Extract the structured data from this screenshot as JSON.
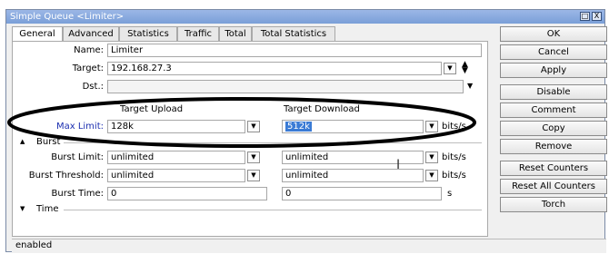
{
  "window": {
    "title": "Simple Queue <Limiter>",
    "title_buttons": [
      "□",
      "X"
    ]
  },
  "tabs": [
    "General",
    "Advanced",
    "Statistics",
    "Traffic",
    "Total",
    "Total Statistics"
  ],
  "general": {
    "name_label": "Name:",
    "name_value": "Limiter",
    "target_label": "Target:",
    "target_value": "192.168.27.3",
    "dst_label": "Dst.:",
    "dst_value": "",
    "col_upload": "Target Upload",
    "col_download": "Target Download",
    "max_limit_label": "Max Limit:",
    "max_limit_upload": "128k",
    "max_limit_download": "512k",
    "max_limit_unit": "bits/s",
    "burst_section": "Burst",
    "burst_limit_label": "Burst Limit:",
    "burst_limit_upload": "unlimited",
    "burst_limit_download": "unlimited",
    "burst_limit_unit": "bits/s",
    "burst_threshold_label": "Burst Threshold:",
    "burst_threshold_upload": "unlimited",
    "burst_threshold_download": "unlimited",
    "burst_threshold_unit": "bits/s",
    "burst_time_label": "Burst Time:",
    "burst_time_upload": "0",
    "burst_time_download": "0",
    "burst_time_unit": "s",
    "time_section": "Time"
  },
  "buttons": {
    "ok": "OK",
    "cancel": "Cancel",
    "apply": "Apply",
    "disable": "Disable",
    "comment": "Comment",
    "copy": "Copy",
    "remove": "Remove",
    "reset_counters": "Reset Counters",
    "reset_all_counters": "Reset All Counters",
    "torch": "Torch"
  },
  "status": "enabled"
}
